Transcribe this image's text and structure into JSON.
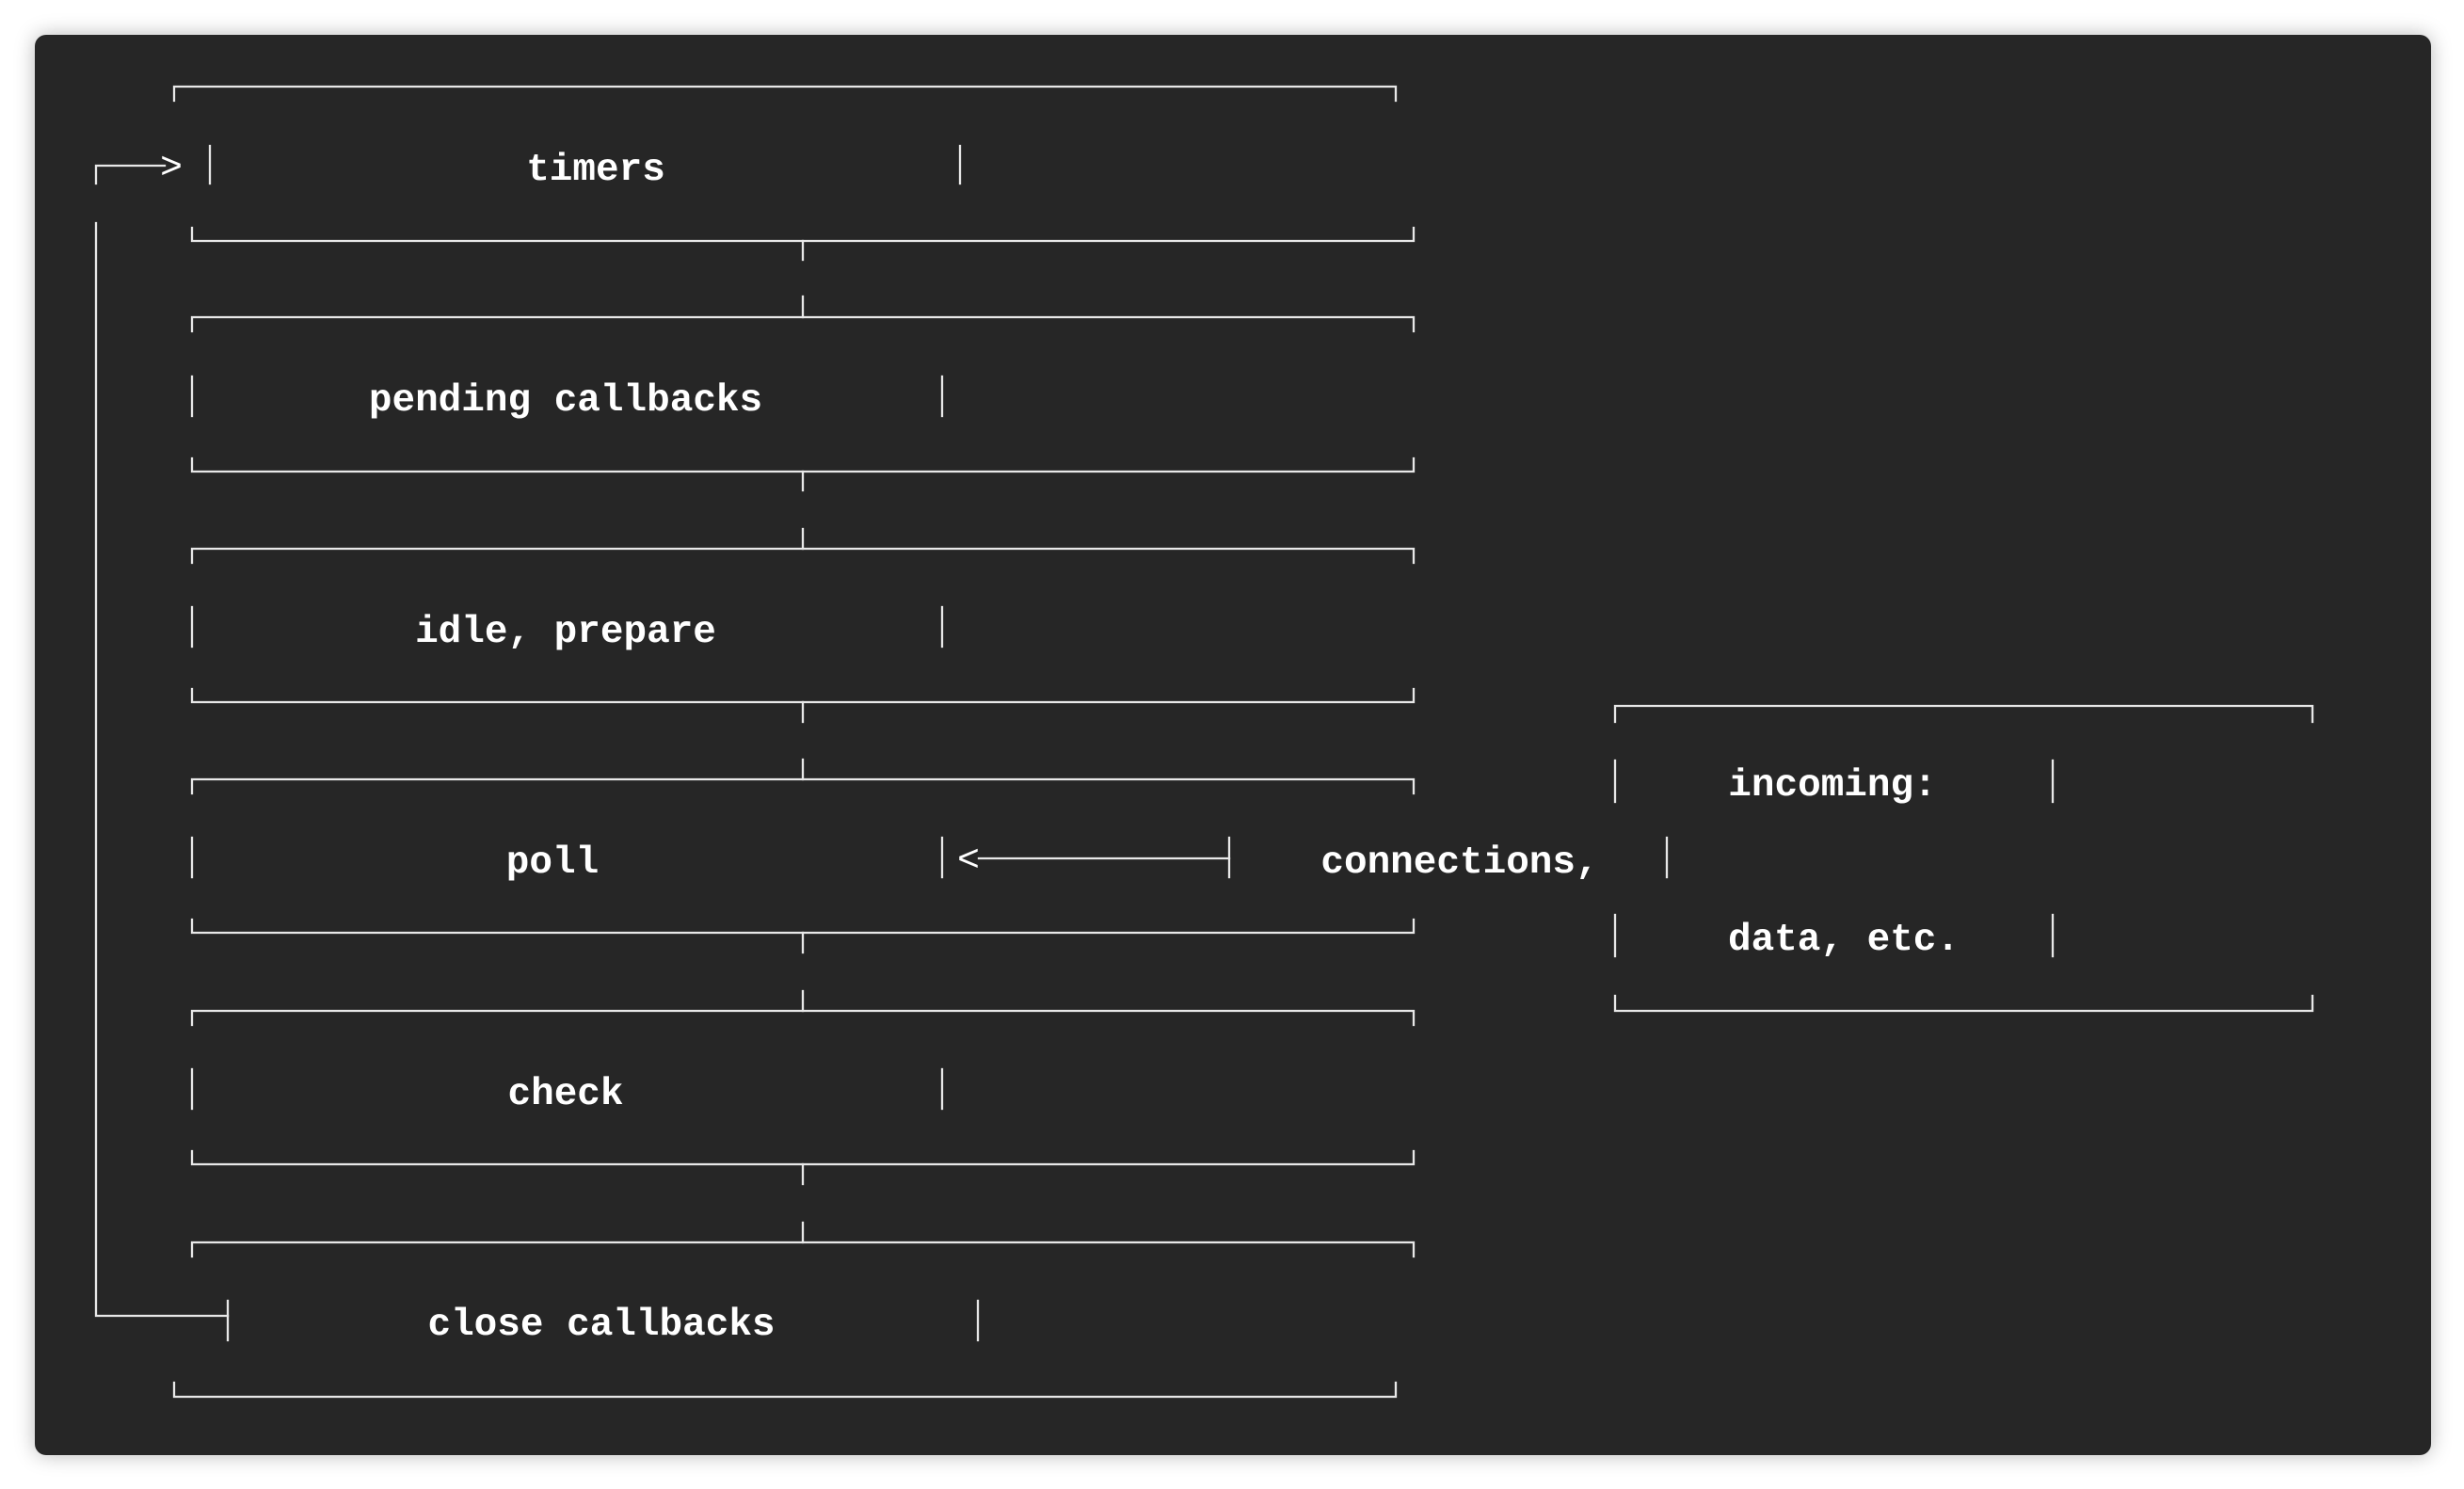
{
  "diagram": {
    "phases": [
      {
        "id": "timers",
        "label": "timers"
      },
      {
        "id": "pending-callbacks",
        "label": "pending callbacks"
      },
      {
        "id": "idle-prepare",
        "label": "idle, prepare"
      },
      {
        "id": "poll",
        "label": "poll"
      },
      {
        "id": "check",
        "label": "check"
      },
      {
        "id": "close-callbacks",
        "label": "close callbacks"
      }
    ],
    "incoming": {
      "line1": "incoming:",
      "line2": "connections,",
      "line3": "data, etc."
    },
    "arrow_heads": {
      "loop": ">",
      "poll": "<"
    },
    "colors": {
      "panel_background": "#262626",
      "page_background": "#ffffff",
      "ink": "#ffffff"
    }
  }
}
